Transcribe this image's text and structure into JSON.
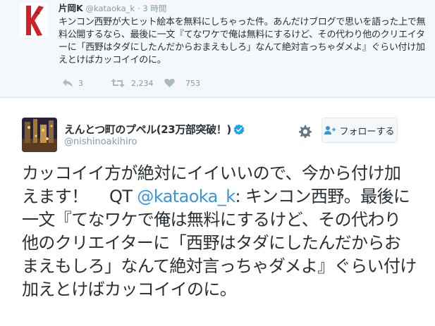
{
  "quoted": {
    "name": "片岡K",
    "handle": "@kataoka_k",
    "separator": "·",
    "time": "3 時間",
    "text": "キンコン西野が大ヒット絵本を無料にしちゃった件。あんだけブログで思いを語った上で無料公開するなら、最後に一文『てなワケで俺は無料にするけど、その代わり他のクリエイターに「西野はタダにしたんだからおまえもしろ」なんて絶対言っちゃダメよ』ぐらい付け加えとけばカッコイイのに。",
    "avatar_letter": "K",
    "actions": {
      "reply_icon": "reply-icon",
      "reply_count": "3",
      "retweet_icon": "retweet-icon",
      "retweet_count": "2,234",
      "like_icon": "heart-icon",
      "like_count": "753"
    }
  },
  "tweet": {
    "name": "えんとつ町のプペル(23万部突破！)",
    "handle": "@nishinoakihiro",
    "follow_label": "フォローする",
    "text_before": "カッコイイ方が絶対にイイいいので、今から付け加えます！　 QT ",
    "qt_mention": "@kataoka_k",
    "text_after": ": キンコン西野。最後に一文『てなワケで俺は無料にするけど、その代わり他のクリエイターに「西野はタダにしたんだからおまえもしろ」なんて絶対言っちゃダメよ』ぐらい付け加えとけばカッコイイのに。"
  },
  "colors": {
    "accent": "#3b94d9",
    "muted": "#8899a6",
    "text": "#292f33",
    "verified": "#1da1f2",
    "quoted_bg": "#f5f8fa",
    "avatar_letter": "#d0202a"
  }
}
